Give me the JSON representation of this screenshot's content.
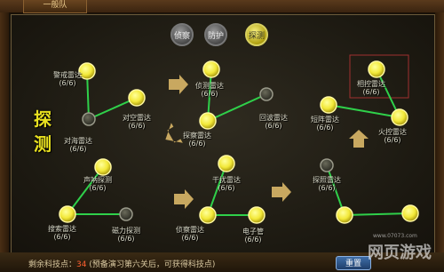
{
  "tab": {
    "label": "一般队"
  },
  "modes": [
    {
      "label": "侦察",
      "active": false
    },
    {
      "label": "防护",
      "active": false
    },
    {
      "label": "探测",
      "active": true
    }
  ],
  "side_title": [
    "探",
    "测"
  ],
  "nodes": [
    {
      "id": "n1",
      "label": "警戒雷达",
      "level": "(6/6)",
      "lit": true
    },
    {
      "id": "n2",
      "label": "对空雷达",
      "level": "(6/6)",
      "lit": true
    },
    {
      "id": "n3",
      "label": "对海雷达",
      "level": "(6/6)",
      "lit": false
    },
    {
      "id": "n4",
      "label": "声呐探测",
      "level": "(6/6)",
      "lit": true
    },
    {
      "id": "n5",
      "label": "搜索雷达",
      "level": "(6/6)",
      "lit": true
    },
    {
      "id": "n6",
      "label": "磁力探测",
      "level": "(6/6)",
      "lit": false
    },
    {
      "id": "n7",
      "label": "侦测雷达",
      "level": "(6/6)",
      "lit": true
    },
    {
      "id": "n8",
      "label": "回波雷达",
      "level": "(6/6)",
      "lit": false
    },
    {
      "id": "n9",
      "label": "探察雷达",
      "level": "(6/6)",
      "lit": true
    },
    {
      "id": "n10",
      "label": "干扰雷达",
      "level": "(6/6)",
      "lit": true
    },
    {
      "id": "n11",
      "label": "侦察雷达",
      "level": "(6/6)",
      "lit": true
    },
    {
      "id": "n12",
      "label": "电子管",
      "level": "(6/6)",
      "lit": true
    },
    {
      "id": "n13",
      "label": "相控雷达",
      "level": "(6/6)",
      "lit": true
    },
    {
      "id": "n14",
      "label": "短阵雷达",
      "level": "(6/6)",
      "lit": true
    },
    {
      "id": "n15",
      "label": "火控雷达",
      "level": "(6/6)",
      "lit": true
    },
    {
      "id": "n16",
      "label": "探照雷达",
      "level": "(6/6)",
      "lit": false
    },
    {
      "id": "n17",
      "label": "",
      "level": "",
      "lit": true
    },
    {
      "id": "n18",
      "label": "",
      "level": "",
      "lit": true
    }
  ],
  "footer": {
    "remain_label": "剩余科技点：",
    "remain_value": "34",
    "note": "(预备演习第六关后，可获得科技点)",
    "confirm_label": "重置"
  },
  "watermark": {
    "text": "网页游戏",
    "url": "www.07073.com"
  },
  "colors": {
    "lit": "#f2e838",
    "line": "#2fd04a",
    "dim": "#9a9a8a"
  }
}
